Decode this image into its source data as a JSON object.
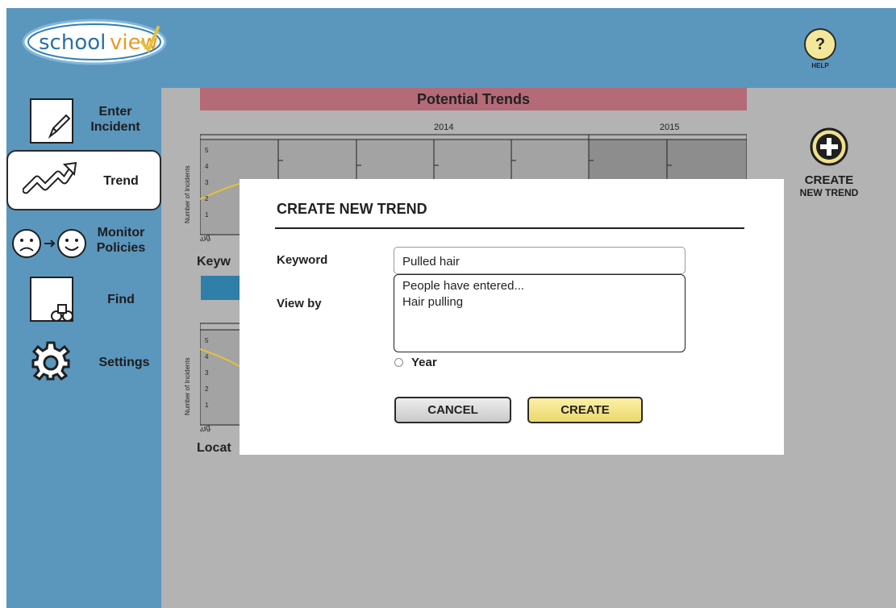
{
  "app": {
    "logo": {
      "part1": "school",
      "part2": "view"
    },
    "help": {
      "symbol": "?",
      "label": "HELP"
    }
  },
  "sidebar": {
    "items": [
      {
        "label_line1": "Enter",
        "label_line2": "Incident",
        "icon": "pencil-note-icon",
        "active": false
      },
      {
        "label_line1": "Trend",
        "label_line2": "",
        "icon": "trend-arrow-icon",
        "active": true
      },
      {
        "label_line1": "Monitor",
        "label_line2": "Policies",
        "icon": "sad-to-happy-icon",
        "active": false
      },
      {
        "label_line1": "Find",
        "label_line2": "",
        "icon": "binoculars-icon",
        "active": false
      },
      {
        "label_line1": "Settings",
        "label_line2": "",
        "icon": "gear-icon",
        "active": false
      }
    ]
  },
  "main": {
    "header": "Potential Trends",
    "years": [
      "2014",
      "2015"
    ],
    "ylabel": "Number of Incidents",
    "yticks": [
      "5",
      "4",
      "3",
      "2",
      "1"
    ],
    "x_start": "Aug",
    "section_labels": [
      "Keyw",
      "Locat"
    ],
    "create_trend": {
      "line1": "CREATE",
      "line2": "NEW TREND"
    }
  },
  "modal": {
    "title": "CREATE NEW TREND",
    "keyword_label": "Keyword",
    "keyword_value": "Pulled hair",
    "viewby_label": "View by",
    "suggestions": [
      "People have entered...",
      "Hair pulling"
    ],
    "radio_year": "Year",
    "cancel_label": "CANCEL",
    "create_label": "CREATE"
  },
  "colors": {
    "app_bg": "#5b96bd",
    "content_bg": "#b3b3b3",
    "header_bg": "#b46a77",
    "chart_fill": "#999999",
    "trend_line": "#e3c23a",
    "create_btn": "#f0e08a",
    "blue_bar": "#2f7fa8"
  }
}
